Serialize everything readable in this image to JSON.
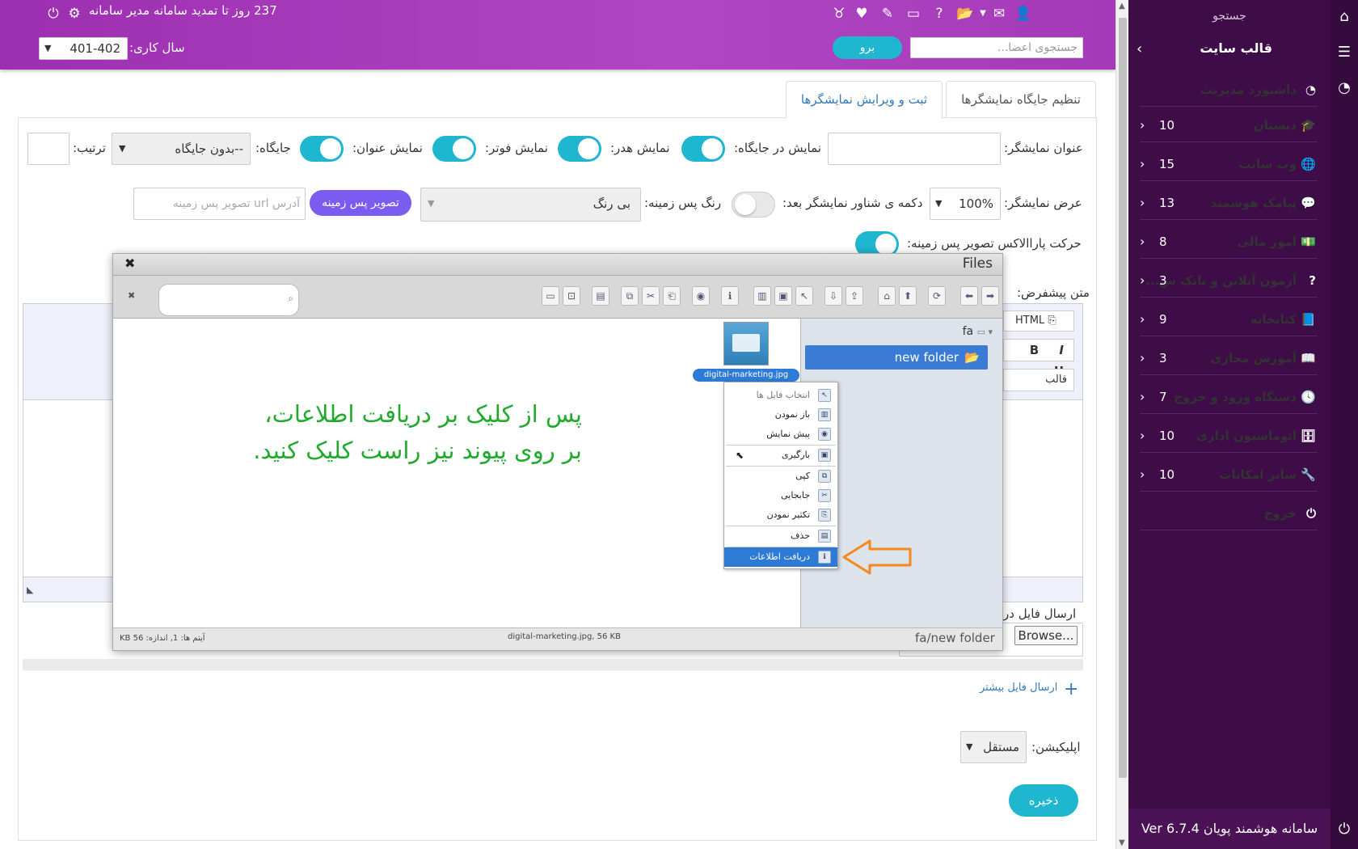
{
  "topbar": {
    "renew_text": "237 روز تا تمدید سامانه مدیر سامانه",
    "year_label": "سال کاری:",
    "year_value": "401-402",
    "go_label": "برو",
    "search_placeholder": "جستجوی اعضا..."
  },
  "sidebar": {
    "search_label": "جستجو",
    "section_title": "قالب سایت",
    "items": [
      {
        "label": "داشبورد مدیریت",
        "count": "",
        "icon": "gauge-icon"
      },
      {
        "label": "دبستان",
        "count": "10",
        "icon": "graduation-cap-icon"
      },
      {
        "label": "وب سایت",
        "count": "15",
        "icon": "globe-icon"
      },
      {
        "label": "پیامک هوشمند",
        "count": "13",
        "icon": "comment-icon"
      },
      {
        "label": "امور مالی",
        "count": "8",
        "icon": "money-icon"
      },
      {
        "label": "آزمون آنلاین و بانک س...",
        "count": "3",
        "icon": "question-icon"
      },
      {
        "label": "کتابخانه",
        "count": "9",
        "icon": "book-icon"
      },
      {
        "label": "آموزش مجازی",
        "count": "3",
        "icon": "reader-icon"
      },
      {
        "label": "دستگاه ورود و خروج",
        "count": "7",
        "icon": "clock-icon"
      },
      {
        "label": "اتوماسیون اداری",
        "count": "10",
        "icon": "office-icon"
      },
      {
        "label": "سایر امکانات",
        "count": "10",
        "icon": "wrench-icon"
      },
      {
        "label": "خروج",
        "count": "",
        "icon": "power-icon"
      }
    ],
    "footer": "سامانه هوشمند پویان  Ver 6.7.4"
  },
  "tabs": {
    "settings": "تنظیم جایگاه نمایشگرها",
    "edit": "ثبت و ویرایش نمایشگرها"
  },
  "form": {
    "title_label": "عنوان نمایشگر:",
    "show_in_place_label": "نمایش در جایگاه:",
    "show_header_label": "نمایش هدر:",
    "show_footer_label": "نمایش فوتر:",
    "show_title_label": "نمایش عنوان:",
    "position_label": "جایگاه:",
    "position_value": "--بدون جایگاه",
    "order_label": "ترتیب:",
    "width_label": "عرض نمایشگر:",
    "width_value": "100%",
    "float_label": "دکمه ی شناور نمایشگر بعد:",
    "bg_color_label": "رنگ پس زمینه:",
    "bg_color_value": "بی رنگ",
    "bg_image_button": "تصویر پس زمینه",
    "bg_url_placeholder": "آدرس url تصویر پس زمینه",
    "parallax_label": "حرکت پاراالاکس تصویر پس زمینه:",
    "default_text_label": "متن پیشفرض:",
    "editor_html": "HTML",
    "editor_format": "قالب",
    "send_file_label": "ارسال فایل در",
    "browse": "Browse...",
    "more_files": "ارسال فایل بیشتر",
    "application_label": "اپلیکیشن:",
    "application_value": "مستقل",
    "save": "ذخیره"
  },
  "dialog": {
    "title": "Files",
    "tree_root": "fa",
    "folder": "new folder",
    "file_name": "digital-marketing.jpg",
    "status_left": "آیتم ها: 1, اندازه: 56 KB",
    "status_center": "digital-marketing.jpg, 56 KB",
    "status_path": "fa/new folder",
    "context_menu": [
      "انتخاب فایل ها",
      "باز نمودن",
      "پیش نمایش",
      "بارگیری",
      "کپی",
      "جابجایی",
      "تکثیر نمودن",
      "حذف",
      "دریافت اطلاعات"
    ]
  },
  "annotation": {
    "line1": "پس از کلیک بر دریافت اطلاعات،",
    "line2": "بر روی پیوند نیز راست کلیک کنید."
  },
  "colors": {
    "purple": "#9c2fb0",
    "cyan": "#1fb6cf",
    "sidebar": "#3e0d48",
    "violet_button": "#7a5cf0",
    "annotation_green": "#1faa2a",
    "arrow_orange": "#f28a1e"
  }
}
